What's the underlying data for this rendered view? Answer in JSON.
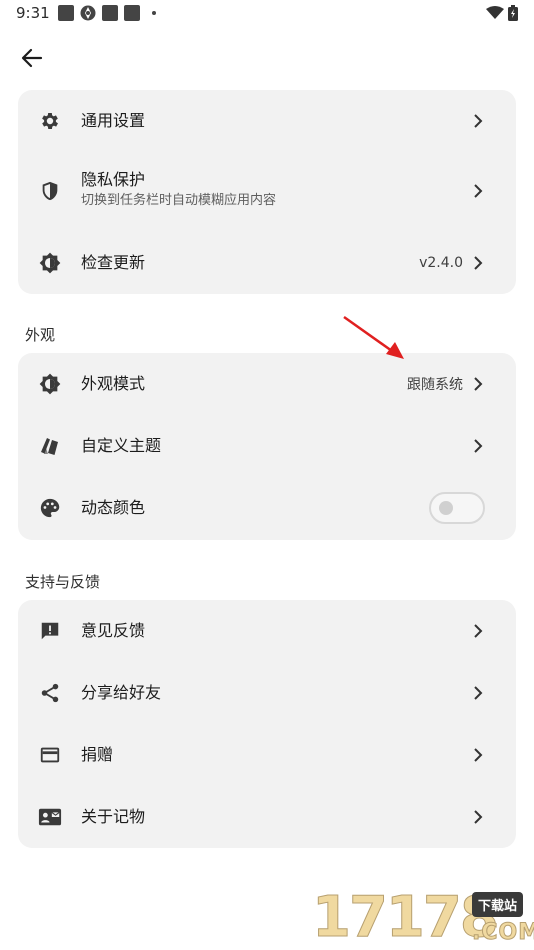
{
  "status_bar": {
    "time": "9:31"
  },
  "cards": {
    "general": {
      "items": [
        {
          "title": "通用设置",
          "icon": "gear-icon"
        },
        {
          "title": "隐私保护",
          "subtitle": "切换到任务栏时自动模糊应用内容",
          "icon": "shield-icon"
        },
        {
          "title": "检查更新",
          "value": "v2.4.0",
          "icon": "brightness-icon"
        }
      ]
    },
    "appearance": {
      "section_label": "外观",
      "items": [
        {
          "title": "外观模式",
          "value": "跟随系统",
          "icon": "brightness-icon"
        },
        {
          "title": "自定义主题",
          "icon": "cards-icon"
        },
        {
          "title": "动态颜色",
          "icon": "palette-icon",
          "toggle": false
        }
      ]
    },
    "support": {
      "section_label": "支持与反馈",
      "items": [
        {
          "title": "意见反馈",
          "icon": "feedback-icon"
        },
        {
          "title": "分享给好友",
          "icon": "share-icon"
        },
        {
          "title": "捐赠",
          "icon": "credit-card-icon"
        },
        {
          "title": "关于记物",
          "icon": "contact-card-icon"
        }
      ]
    }
  },
  "watermark": {
    "number": "17178",
    "tag": "下载站",
    "suffix": ".COM"
  },
  "colors": {
    "card_bg": "#f2f2f2",
    "annotation_arrow": "#e02020"
  }
}
